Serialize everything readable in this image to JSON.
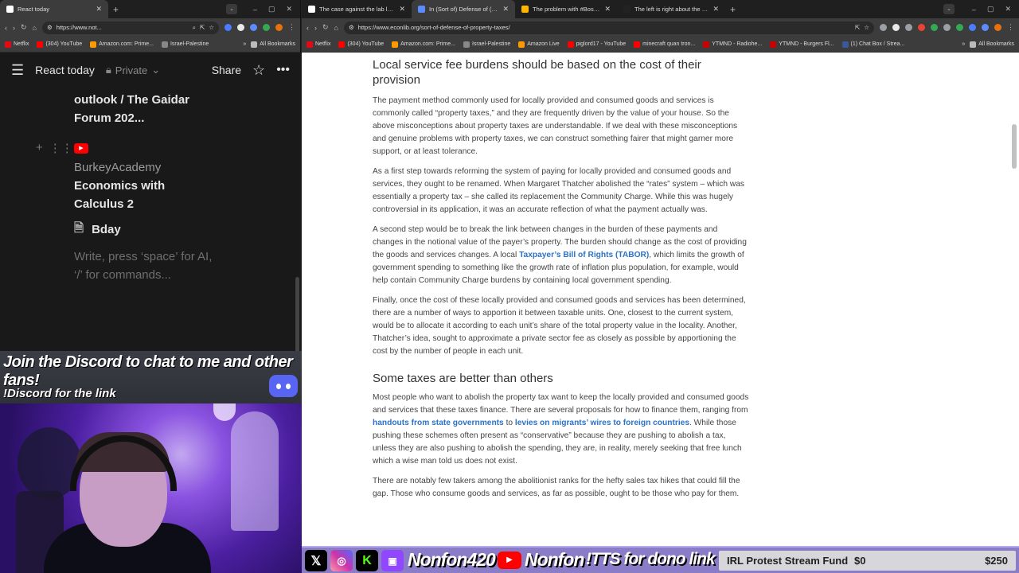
{
  "left_browser": {
    "tabs": [
      {
        "title": "React today",
        "favicon_color": "#ffffff"
      }
    ],
    "address": "https://www.not...",
    "bookmarks": [
      {
        "label": "Netflix",
        "color": "#e50914"
      },
      {
        "label": "(304) YouTube",
        "color": "#ff0000"
      },
      {
        "label": "Amazon.com: Prime...",
        "color": "#ff9900"
      },
      {
        "label": "Israel-Palestine",
        "color": "#888888"
      }
    ],
    "bookmarks_more": "»",
    "all_bookmarks": "All Bookmarks"
  },
  "notion": {
    "page_title": "React today",
    "privacy": "Private",
    "share": "Share",
    "link_text": "outlook / The Gaidar Forum 202...",
    "channel_prefix": "BurkeyAcademy",
    "channel_title": "Economics with Calculus 2",
    "page_link": "Bday",
    "placeholder": "Write, press ‘space’ for AI, ‘/’ for commands..."
  },
  "right_browser": {
    "tabs": [
      {
        "title": "The case against the lab leak h",
        "favicon_color": "#ffffff"
      },
      {
        "title": "In (Sort of) Defense of (Someth",
        "favicon_color": "#5b8cff"
      },
      {
        "title": "The problem with #BossBabe li",
        "favicon_color": "#ffb400"
      },
      {
        "title": "The left is right about the Dem",
        "favicon_color": "#222222"
      }
    ],
    "address": "https://www.econlib.org/sort-of-defense-of-property-taxes/",
    "bookmarks": [
      {
        "label": "Netflix",
        "color": "#e50914"
      },
      {
        "label": "(304) YouTube",
        "color": "#ff0000"
      },
      {
        "label": "Amazon.com: Prime...",
        "color": "#ff9900"
      },
      {
        "label": "Israel-Palestine",
        "color": "#888888"
      },
      {
        "label": "Amazon Live",
        "color": "#ff9900"
      },
      {
        "label": "piglord17 - YouTube",
        "color": "#ff0000"
      },
      {
        "label": "minecraft quan tron...",
        "color": "#ff0000"
      },
      {
        "label": "YTMND - Radiohe...",
        "color": "#cc0000"
      },
      {
        "label": "YTMND - Burgers Fl...",
        "color": "#cc0000"
      },
      {
        "label": "(1) Chat Box / Strea...",
        "color": "#3b5998"
      }
    ],
    "bookmarks_more": "»",
    "all_bookmarks": "All Bookmarks"
  },
  "article": {
    "h1": "Local service fee burdens should be based on the cost of their provision",
    "p1": "The payment method commonly used for locally provided and consumed goods and services is commonly called “property taxes,” and they are frequently driven by the value of your house. So the above misconceptions about property taxes are understandable. If we deal with these misconceptions and genuine problems with property taxes, we can construct something fairer that might garner more support, or at least tolerance.",
    "p2": "As a first step towards reforming the system of paying for locally provided and consumed goods and services, they ought to be renamed. When Margaret Thatcher abolished the “rates” system – which was essentially a property tax – she called its replacement the Community Charge. While this was hugely controversial in its application, it was an accurate reflection of what the payment actually was.",
    "p3_a": "A second step would be to break the link between changes in the burden of these payments and changes in the notional value of the payer’s property. The burden should change as the cost of providing the goods and services changes. A local ",
    "p3_link": "Taxpayer’s Bill of Rights (TABOR)",
    "p3_b": ", which limits the growth of government spending to something like the growth rate of inflation plus population, for example, would help contain Community Charge burdens by containing local government spending.",
    "p4": "Finally, once the cost of these locally provided and consumed goods and services has been determined, there are a number of ways to apportion it between taxable units. One, closest to the current system, would be to allocate it according to each unit’s share of the total property value in the locality. Another, Thatcher’s idea, sought to approximate a private sector fee as closely as possible by apportioning the cost by the number of people in each unit.",
    "h2": "Some taxes are better than others",
    "p5_a": "Most people who want to abolish the property tax want to keep the locally provided and consumed goods and services that these taxes finance. There are several proposals for how to finance them, ranging from ",
    "p5_link1": "handouts from state governments",
    "p5_mid": " to ",
    "p5_link2": "levies on migrants’ wires to foreign countries",
    "p5_b": ". While those pushing these schemes often present as “conservative” because they are pushing to abolish a tax, unless they are also pushing to abolish the spending, they are, in reality, merely seeking that free lunch which a wise man told us does not exist.",
    "p6": "There are notably few takers among the abolitionist ranks for the hefty sales tax hikes that could fill the gap. Those who consume goods and services, as far as possible, ought to be those who pay for them."
  },
  "overlay": {
    "discord_headline": "Join the Discord to chat to me and other fans!",
    "discord_cmd": "!Discord for the link",
    "handle1": "Nonfon420",
    "handle2": "Nonfon",
    "tts": "!TTS for dono link",
    "fund_name": "IRL Protest Stream Fund",
    "fund_current": "$0",
    "fund_goal": "$250"
  }
}
